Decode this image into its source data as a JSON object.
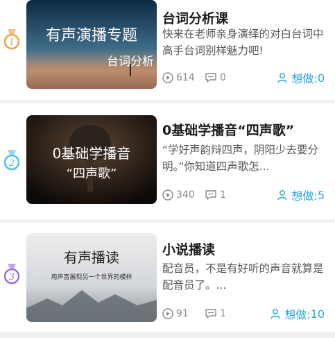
{
  "courses": [
    {
      "rank": "1",
      "medal_color": "#f0a04b",
      "thumb_text": [
        "有声演播专题",
        "台词分析"
      ],
      "title": "台词分析课",
      "description": "快来在老师亲身演绎的对白台词中高手台词别样魅力吧!",
      "plays": "614",
      "comments": "0",
      "want_label": "想做:",
      "want_count": "0"
    },
    {
      "rank": "2",
      "medal_color": "#4ec3ea",
      "thumb_text": [
        "0基础学播音",
        "“四声歌”"
      ],
      "title": "0基础学播音“四声歌”",
      "description": "“学好声韵辩四声，阴阳少去要分明。”你知道四声歌怎...",
      "plays": "340",
      "comments": "1",
      "want_label": "想做:",
      "want_count": "5"
    },
    {
      "rank": "3",
      "medal_color": "#9b6fd6",
      "thumb_text": [
        "有声播读",
        "用声音展现另一个世界的模样"
      ],
      "title": "小说播读",
      "description": "配音员，不是有好听的声音就算是配音员了。...",
      "plays": "91",
      "comments": "1",
      "want_label": "想做:",
      "want_count": "10"
    }
  ]
}
